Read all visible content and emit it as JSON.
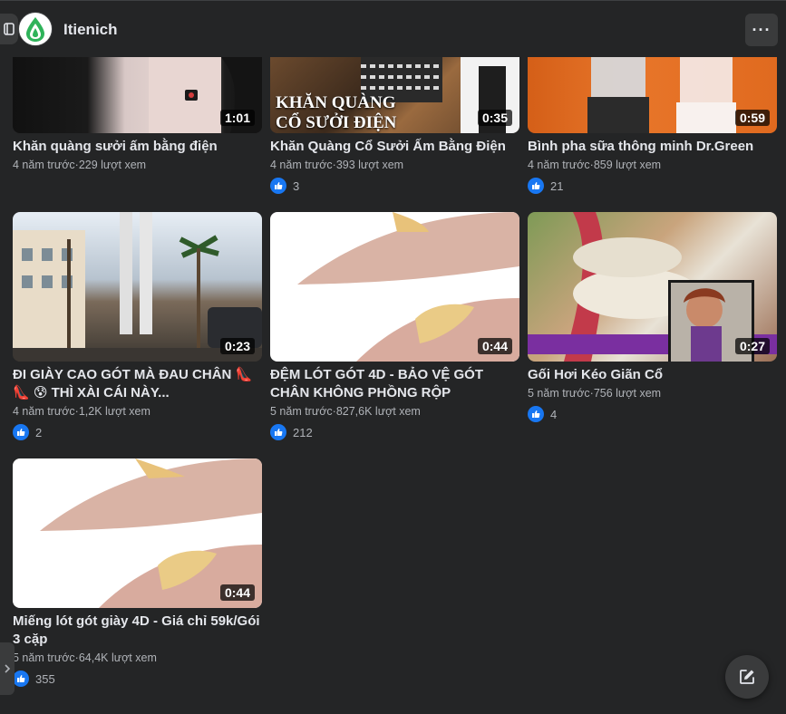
{
  "header": {
    "page_name": "Itienich",
    "more_label": "···"
  },
  "videos": [
    {
      "title": "Khăn quàng sưởi ấm bằng điện",
      "meta": "4 năm trước·229 lượt xem",
      "duration": "1:01",
      "likes": ""
    },
    {
      "title": "Khăn Quàng Cổ Sưởi Ấm Bằng Điện",
      "meta": "4 năm trước·393 lượt xem",
      "duration": "0:35",
      "likes": "3",
      "thumb_text": "KHĂN QUÀNG CỔ SƯỞI ĐIỆN"
    },
    {
      "title": "Bình pha sữa thông minh Dr.Green",
      "meta": "4 năm trước·859 lượt xem",
      "duration": "0:59",
      "likes": "21"
    },
    {
      "title": "ĐI GIÀY CAO GÓT MÀ ĐAU CHÂN 👠👠 😰 THÌ XÀI CÁI NÀY...",
      "meta": "4 năm trước·1,2K lượt xem",
      "duration": "0:23",
      "likes": "2"
    },
    {
      "title": "ĐỆM LÓT GÓT 4D - BẢO VỆ GÓT CHÂN KHÔNG PHỒNG RỘP",
      "meta": "5 năm trước·827,6K lượt xem",
      "duration": "0:44",
      "likes": "212"
    },
    {
      "title": "Gối Hơi Kéo Giãn Cổ",
      "meta": "5 năm trước·756 lượt xem",
      "duration": "0:27",
      "likes": "4"
    },
    {
      "title": "Miếng lót gót giày 4D - Giá chỉ 59k/Gói 3 cặp",
      "meta": "5 năm trước·64,4K lượt xem",
      "duration": "0:44",
      "likes": "355"
    }
  ],
  "colors": {
    "background": "#242526",
    "accent": "#1877f2",
    "text_primary": "#e4e6eb",
    "text_secondary": "#b0b3b8"
  }
}
